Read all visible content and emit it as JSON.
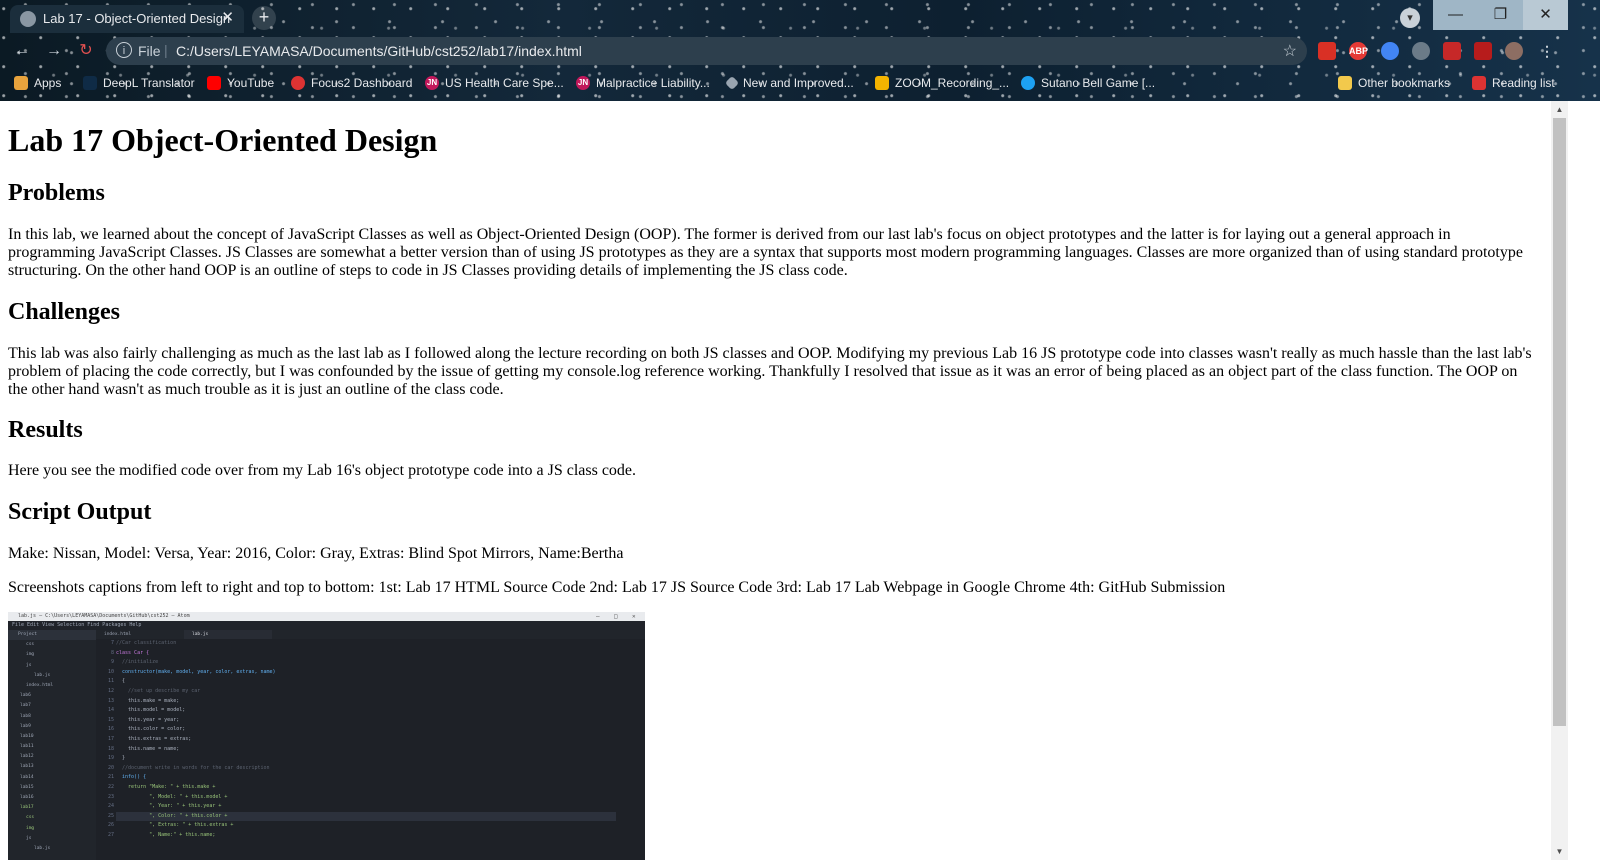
{
  "browser": {
    "tab_title": "Lab 17 - Object-Oriented Design",
    "tab_close": "✕",
    "new_tab": "+",
    "profile": "▾",
    "window_controls": {
      "minimize": "—",
      "restore": "❐",
      "close": "✕"
    },
    "nav": {
      "back": "←",
      "forward": "→",
      "reload": "↻"
    },
    "address": {
      "info_icon": "i",
      "scheme": "File",
      "separator": "|",
      "url": "C:/Users/LEYAMASA/Documents/GitHub/cst252/lab17/index.html",
      "star": "☆"
    },
    "extensions": [
      "ABP"
    ],
    "bookmarks": [
      {
        "label": "Apps",
        "icon": "apps-grid-icon",
        "color": "#e8a33d"
      },
      {
        "label": "DeepL Translator",
        "icon": "deepl-icon",
        "color": "#0f2b46"
      },
      {
        "label": "YouTube",
        "icon": "youtube-icon",
        "color": "#ff0000"
      },
      {
        "label": "Focus2 Dashboard",
        "icon": "focus2-icon",
        "color": "#d33"
      },
      {
        "label": "US Health Care Spe...",
        "icon": "jn-icon",
        "color": "#c2185b",
        "badge": "JN"
      },
      {
        "label": "Malpractice Liability...",
        "icon": "jn-icon",
        "color": "#c2185b",
        "badge": "JN"
      },
      {
        "label": "New and Improved...",
        "icon": "diamond-icon",
        "color": "#9aa5b1"
      },
      {
        "label": "ZOOM_Recording_...",
        "icon": "google-drive-icon",
        "color": "#f4b400"
      },
      {
        "label": "Sutano Bell Game [...",
        "icon": "twitter-icon",
        "color": "#1da1f2"
      }
    ],
    "other_bookmarks": "Other bookmarks",
    "reading_list": "Reading list"
  },
  "page": {
    "title": "Lab 17 Object-Oriented Design",
    "sections": [
      {
        "heading": "Problems",
        "body": "In this lab, we learned about the concept of JavaScript Classes as well as Object-Oriented Design (OOP). The former is derived from our last lab's focus on object prototypes and the latter is for laying out a general approach in programming JavaScript Classes. JS Classes are somewhat a better version than of using JS prototypes as they are a syntax that supports most modern programming languages. Classes are more organized than of using standard prototype structuring. On the other hand OOP is an outline of steps to code in JS Classes providing details of implementing the JS class code."
      },
      {
        "heading": "Challenges",
        "body": "This lab was also fairly challenging as much as the last lab as I followed along the lecture recording on both JS classes and OOP. Modifying my previous Lab 16 JS prototype code into classes wasn't really as much hassle than the last lab's problem of placing the code correctly, but I was confounded by the issue of getting my console.log reference working. Thankfully I resolved that issue as it was an error of being placed as an object part of the class function. The OOP on the other hand wasn't as much trouble as it is just an outline of the class code."
      },
      {
        "heading": "Results",
        "body": "Here you see the modified code over from my Lab 16's object prototype code into a JS class code."
      },
      {
        "heading": "Script Output",
        "body": "Make: Nissan, Model: Versa, Year: 2016, Color: Gray, Extras: Blind Spot Mirrors, Name:Bertha"
      }
    ],
    "caption": "Screenshots captions from left to right and top to bottom: 1st: Lab 17 HTML Source Code 2nd: Lab 17 JS Source Code 3rd: Lab 17 Lab Webpage in Google Chrome 4th: GitHub Submission"
  },
  "screenshot": {
    "titlebar": "lab.js — C:\\Users\\LEYAMASA\\Documents\\GitHub\\cst252 — Atom",
    "menu": "File   Edit   View   Selection   Find   Packages   Help",
    "tree_header": "Project",
    "tabs": [
      "index.html",
      "lab.js"
    ],
    "tree_items": [
      "css",
      "img",
      "js",
      "lab.js",
      "index.html",
      "lab6",
      "lab7",
      "lab8",
      "lab9",
      "lab10",
      "lab11",
      "lab12",
      "lab13",
      "lab14",
      "lab15",
      "lab16",
      "lab17",
      "css",
      "img",
      "js",
      "lab.js"
    ],
    "line_numbers": [
      "7",
      "8",
      "9",
      "10",
      "11",
      "12",
      "13",
      "14",
      "15",
      "16",
      "17",
      "18",
      "19",
      "20",
      "21",
      "22",
      "23",
      "24",
      "25",
      "26",
      "27"
    ],
    "code_lines": [
      "//Car classification",
      "class Car {",
      "  //initialize",
      "  constructor(make, model, year, color, extras, name)",
      "  {",
      "    //set up describe my car",
      "    this.make = make;",
      "    this.model = model;",
      "    this.year = year;",
      "    this.color = color;",
      "    this.extras = extras;",
      "    this.name = name;",
      "  }",
      "  //document write in words for the car description",
      "  info() {",
      "    return \"Make: \" + this.make +",
      "           \", Model: \" + this.model +",
      "           \", Year: \" + this.year +",
      "           \", Color: \" + this.color +",
      "           \", Extras: \" + this.extras +",
      "           \", Name:\" + this.name;"
    ]
  },
  "scrollbar": {
    "up": "▲",
    "down": "▼"
  }
}
